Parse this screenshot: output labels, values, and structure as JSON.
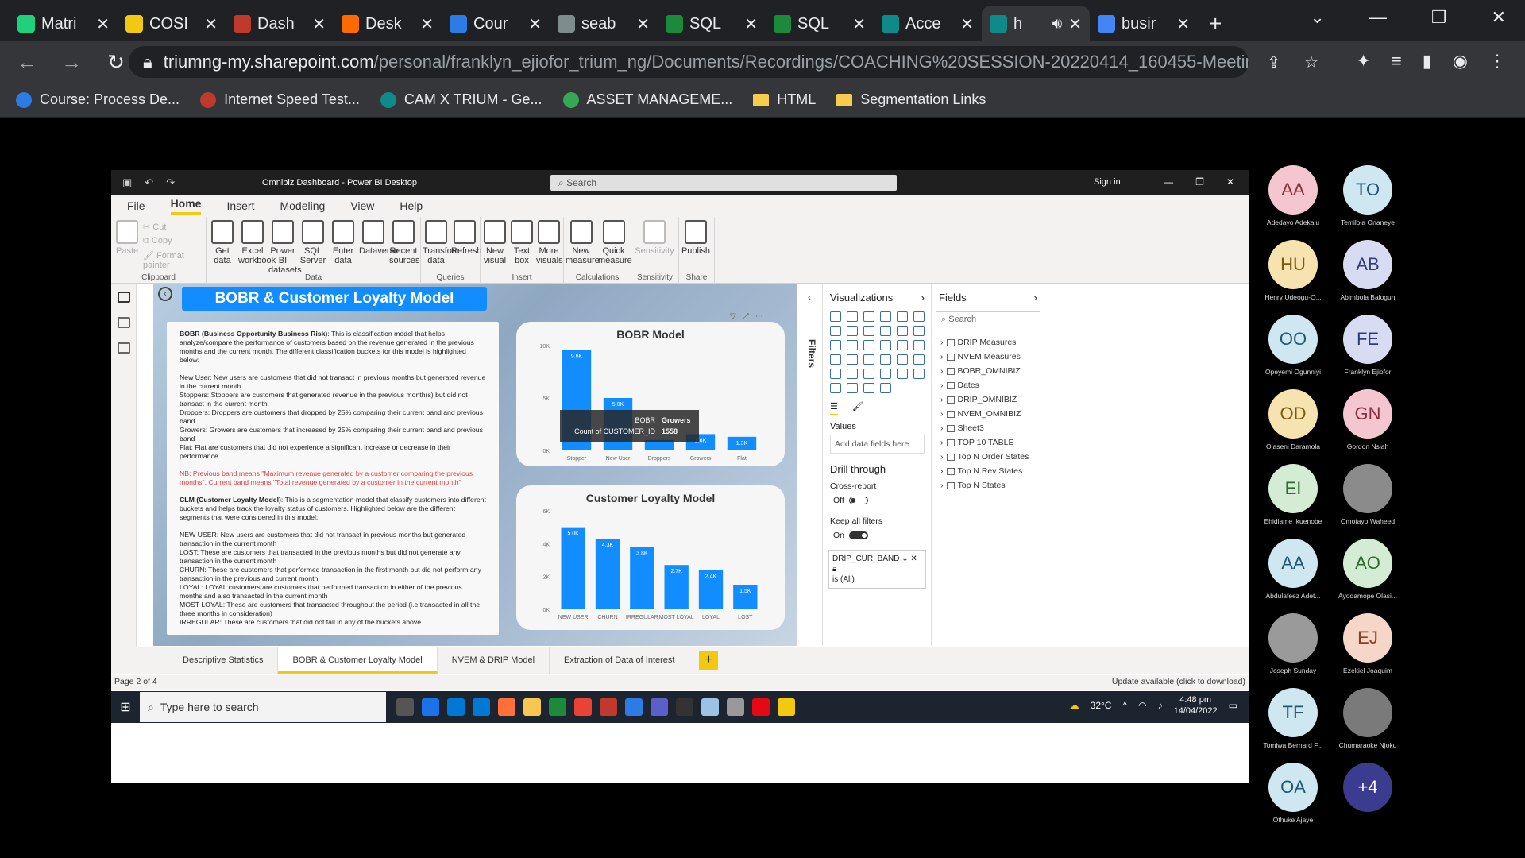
{
  "browser": {
    "tabs": [
      {
        "title": "Matri",
        "color": "#21d07a"
      },
      {
        "title": "COSI",
        "color": "#f2c811"
      },
      {
        "title": "Dash",
        "color": "#c0392b"
      },
      {
        "title": "Desk",
        "color": "#ff6a00"
      },
      {
        "title": "Cour",
        "color": "#2d7be5"
      },
      {
        "title": "seab",
        "color": "#7f8c8d"
      },
      {
        "title": "SQL",
        "color": "#1b8a3a"
      },
      {
        "title": "SQL",
        "color": "#1b8a3a"
      },
      {
        "title": "Acce",
        "color": "#0f8a8a"
      },
      {
        "title": "h",
        "color": "#0f8a8a"
      },
      {
        "title": "busir",
        "color": "#4285f4"
      }
    ],
    "url_host": "triumng-my.sharepoint.com",
    "url_path": "/personal/franklyn_ejiofor_trium_ng/Documents/Recordings/COACHING%20SESSION-20220414_160455-Meeting%...",
    "bookmarks": [
      {
        "label": "Course: Process De...",
        "icon": "circle-blue"
      },
      {
        "label": "Internet Speed Test...",
        "icon": "gauge-red"
      },
      {
        "label": "CAM X TRIUM - Ge...",
        "icon": "sharepoint"
      },
      {
        "label": "ASSET MANAGEME...",
        "icon": "drive"
      },
      {
        "label": "HTML",
        "icon": "folder"
      },
      {
        "label": "Segmentation Links",
        "icon": "folder"
      }
    ]
  },
  "pbi": {
    "window_title": "Omnibiz Dashboard - Power BI Desktop",
    "search_placeholder": "Search",
    "sign_in": "Sign in",
    "menu": [
      "File",
      "Home",
      "Insert",
      "Modeling",
      "View",
      "Help"
    ],
    "active_menu": "Home",
    "clipboard": {
      "paste": "Paste",
      "cut": "Cut",
      "copy": "Copy",
      "format_painter": "Format painter",
      "group": "Clipboard"
    },
    "data_group": {
      "buttons": [
        "Get data",
        "Excel workbook",
        "Power BI datasets",
        "SQL Server",
        "Enter data",
        "Dataverse",
        "Recent sources"
      ],
      "group": "Data"
    },
    "queries_group": {
      "buttons": [
        "Transform data",
        "Refresh"
      ],
      "group": "Queries"
    },
    "insert_group": {
      "buttons": [
        "New visual",
        "Text box",
        "More visuals"
      ],
      "group": "Insert"
    },
    "calc_group": {
      "buttons": [
        "New measure",
        "Quick measure"
      ],
      "group": "Calculations"
    },
    "sensitivity_group": {
      "buttons": [
        "Sensitivity"
      ],
      "group": "Sensitivity"
    },
    "share_group": {
      "buttons": [
        "Publish"
      ],
      "group": "Share"
    },
    "report_title": "BOBR & Customer Loyalty Model",
    "textbox": {
      "bobr_heading": "BOBR (Business Opportunity Business Risk)",
      "bobr_intro": ": This is classification model that helps analyze/compare the performance of customers based on the revenue generated in the previous months and the current month. The different classification buckets for this model is highlighted below:",
      "bobr_lines": [
        "New User: New users are customers that did not transact in previous months but generated revenue in the current month",
        "Stoppers: Stoppers are customers that generated revenue in the previous month(s) but did not transact in the current month.",
        "Droppers: Droppers are customers that dropped by 25% comparing their current band and previous band",
        "Growers: Growers are customers that increased by 25% comparing their current band and previous band",
        "Flat: Flat are customers that did not experience a significant increase or decrease in their performance"
      ],
      "nb": "NB: Previous band means \"Maximum revenue generated by a customer comparing the previous months\". Current band means \"Total revenue generated by a customer in the current month\"",
      "clm_heading": "CLM (Customer Loyalty Model)",
      "clm_intro": ": This is a segmentation model that classify customers into different buckets and helps track the loyalty status of customers. Highlighted below are the different segments that were considered in this model:",
      "clm_lines": [
        "NEW USER: New users are customers that did not transact in previous months but generated transaction in the current month",
        "LOST: These are customers that transacted in the previous months but did not generate any transaction in the current month",
        "CHURN: These are customers that performed transaction in the first month but did not perform any transaction in the previous and current month",
        "LOYAL: LOYAL customers are customers that performed transaction in either of the previous months and also transacted in the current month",
        "MOST LOYAL: These are customers that transacted throughout the period (i.e transacted in all the three months in consideration)",
        "IRREGULAR: These are customers that did not fall in any of the buckets above"
      ]
    },
    "tooltip": {
      "k1": "BOBR",
      "v1": "Growers",
      "k2": "Count of CUSTOMER_ID",
      "v2": "1558"
    },
    "visualizations_title": "Visualizations",
    "values_label": "Values",
    "add_fields": "Add data fields here",
    "drill_through": "Drill through",
    "cross_report": "Cross-report",
    "cross_report_state": "Off",
    "keep_filters": "Keep all filters",
    "keep_filters_state": "On",
    "filter_card": {
      "field": "DRIP_CUR_BAND",
      "value": "is (All)"
    },
    "filters_label": "Filters",
    "fields_title": "Fields",
    "fields_search": "Search",
    "fields": [
      "DRIP Measures",
      "NVEM Measures",
      "BOBR_OMNIBIZ",
      "Dates",
      "DRIP_OMNIBIZ",
      "NVEM_OMNIBIZ",
      "Sheet3",
      "TOP 10 TABLE",
      "Top N Order States",
      "Top N Rev States",
      "Top N States"
    ],
    "pages": [
      "Descriptive Statistics",
      "BOBR & Customer Loyalty Model",
      "NVEM & DRIP Model",
      "Extraction of Data of Interest"
    ],
    "active_page": 1,
    "page_indicator": "Page 2 of 4",
    "update_notice": "Update available (click to download)"
  },
  "taskbar": {
    "search_placeholder": "Type here to search",
    "temperature": "32°C",
    "time": "4:48 pm",
    "date": "14/04/2022"
  },
  "participants": [
    {
      "initials": "AA",
      "name": "Adedayo Adekalu",
      "bg": "#f4c6cf",
      "fg": "#8a2e3f"
    },
    {
      "initials": "TO",
      "name": "Temiloła Onaneye",
      "bg": "#cfe7f1",
      "fg": "#1f5a73"
    },
    {
      "initials": "HU",
      "name": "Henry Udeogu-O...",
      "bg": "#f6e3b0",
      "fg": "#7a5a10"
    },
    {
      "initials": "AB",
      "name": "Abimbola Balogun",
      "bg": "#d7dcf3",
      "fg": "#2f3d7a"
    },
    {
      "initials": "OO",
      "name": "Opeyemi Ogunniyi",
      "bg": "#cfe7f1",
      "fg": "#1f5a73"
    },
    {
      "initials": "FE",
      "name": "Franklyn Ejiofor",
      "bg": "#d7dcf3",
      "fg": "#2f3d7a"
    },
    {
      "initials": "OD",
      "name": "Olaseni Daramola",
      "bg": "#f6e3b0",
      "fg": "#7a5a10"
    },
    {
      "initials": "GN",
      "name": "Gordon Nsiah",
      "bg": "#f4c6cf",
      "fg": "#8a2e3f"
    },
    {
      "initials": "EI",
      "name": "Ehidiame Ikuenobe",
      "bg": "#d5ecd4",
      "fg": "#2f6a2e"
    },
    {
      "initials": "",
      "name": "Omotayo Waheed",
      "bg": "#8b8b8b",
      "fg": "#fff"
    },
    {
      "initials": "AA",
      "name": "Abdulafeez Adet...",
      "bg": "#cfe7f1",
      "fg": "#1f5a73"
    },
    {
      "initials": "AO",
      "name": "Ayodamope Olasi...",
      "bg": "#d5ecd4",
      "fg": "#2f6a2e"
    },
    {
      "initials": "",
      "name": "Joseph Sunday",
      "bg": "#9a9a9a",
      "fg": "#fff"
    },
    {
      "initials": "EJ",
      "name": "Ezekiel Joaquim",
      "bg": "#f6d6c8",
      "fg": "#8a3f20"
    },
    {
      "initials": "TF",
      "name": "Tomiwa Bernard F...",
      "bg": "#cfe7f1",
      "fg": "#1f5a73"
    },
    {
      "initials": "",
      "name": "Chumaraoke Njoku",
      "bg": "#7a7a7a",
      "fg": "#fff"
    },
    {
      "initials": "OA",
      "name": "Othuke Ajaye",
      "bg": "#cfe7f1",
      "fg": "#1f5a73"
    },
    {
      "initials": "+4",
      "name": "",
      "bg": "#3b3b8f",
      "fg": "#fff"
    }
  ],
  "chart_data": [
    {
      "type": "bar",
      "title": "BOBR Model",
      "categories": [
        "Stopper",
        "New User",
        "Droppers",
        "Growers",
        "Flat"
      ],
      "values": [
        9600,
        5000,
        1000,
        1558,
        1300
      ],
      "data_labels": [
        "9.6K",
        "5.0K",
        "",
        "1.6K",
        "1.3K"
      ],
      "ylim": [
        0,
        10000
      ],
      "yticks": [
        "0K",
        "5K",
        "10K"
      ],
      "color": "#118dff"
    },
    {
      "type": "bar",
      "title": "Customer Loyalty Model",
      "categories": [
        "NEW USER",
        "CHURN",
        "IRREGULAR",
        "MOST LOYAL",
        "LOYAL",
        "LOST"
      ],
      "values": [
        5000,
        4300,
        3800,
        2700,
        2400,
        1500
      ],
      "data_labels": [
        "5.0K",
        "4.3K",
        "3.8K",
        "2.7K",
        "2.4K",
        "1.5K"
      ],
      "ylim": [
        0,
        6000
      ],
      "yticks": [
        "0K",
        "2K",
        "4K",
        "6K"
      ],
      "color": "#118dff"
    }
  ]
}
